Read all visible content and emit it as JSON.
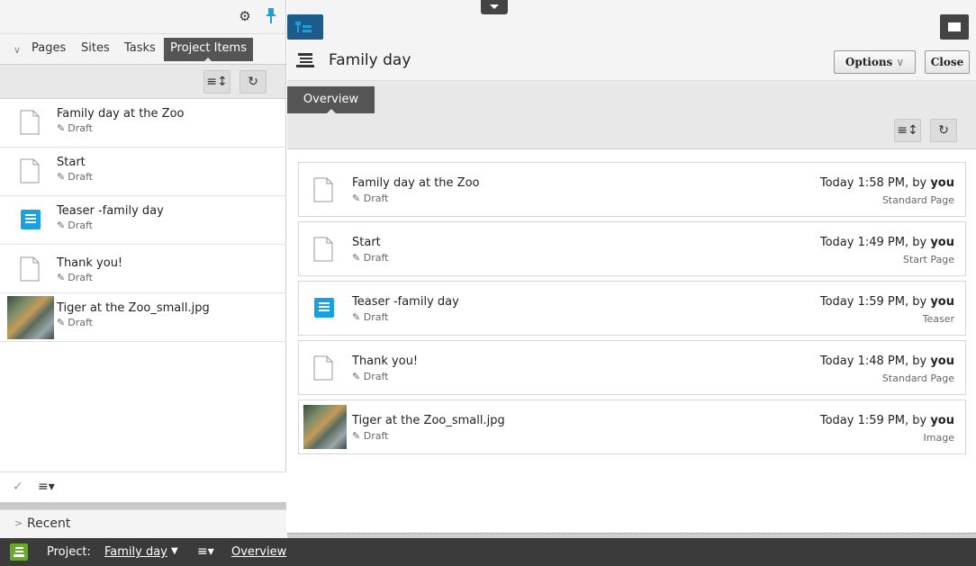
{
  "left_panel": {
    "tabs": [
      "Pages",
      "Sites",
      "Tasks",
      "Project Items"
    ],
    "active_tab": "Project Items",
    "items": [
      {
        "title": "Family day at the Zoo",
        "status": "Draft",
        "icon": "page-icon"
      },
      {
        "title": "Start",
        "status": "Draft",
        "icon": "page-icon"
      },
      {
        "title": "Teaser -family day",
        "status": "Draft",
        "icon": "teaser-block-icon"
      },
      {
        "title": "Thank you!",
        "status": "Draft",
        "icon": "page-icon"
      },
      {
        "title": "Tiger at the Zoo_small.jpg",
        "status": "Draft",
        "icon": "image-thumbnail"
      }
    ],
    "recent_label": "Recent"
  },
  "main": {
    "title": "Family day",
    "options_label": "Options",
    "close_label": "Close",
    "tab_label": "Overview",
    "cards": [
      {
        "title": "Family day at the Zoo",
        "status": "Draft",
        "when_prefix": "Today 1:58 PM, by",
        "by": "you",
        "type": "Standard Page",
        "icon": "page-icon"
      },
      {
        "title": "Start",
        "status": "Draft",
        "when_prefix": "Today 1:49 PM, by",
        "by": "you",
        "type": "Start Page",
        "icon": "page-icon"
      },
      {
        "title": "Teaser -family day",
        "status": "Draft",
        "when_prefix": "Today 1:59 PM, by",
        "by": "you",
        "type": "Teaser",
        "icon": "teaser-block-icon"
      },
      {
        "title": "Thank you!",
        "status": "Draft",
        "when_prefix": "Today 1:48 PM, by",
        "by": "you",
        "type": "Standard Page",
        "icon": "page-icon"
      },
      {
        "title": "Tiger at the Zoo_small.jpg",
        "status": "Draft",
        "when_prefix": "Today 1:59 PM, by",
        "by": "you",
        "type": "Image",
        "icon": "image-thumbnail"
      }
    ]
  },
  "statusbar": {
    "project_label": "Project:",
    "project_name": "Family day",
    "overview_link": "Overview"
  },
  "colors": {
    "accent_blue": "#1aa0db",
    "tree_button": "#1c5b8a",
    "project_green": "#6aaa2a",
    "dark_bar": "#3b3b3b"
  }
}
